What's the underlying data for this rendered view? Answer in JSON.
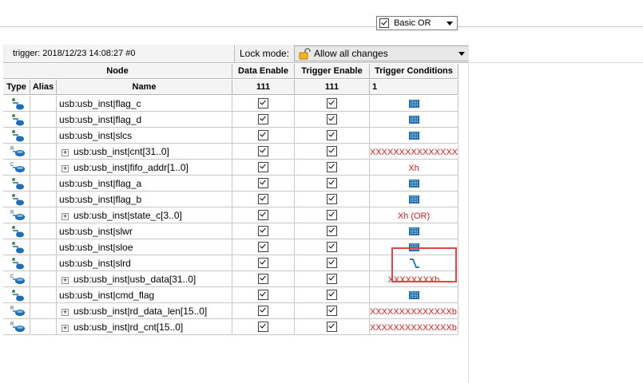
{
  "toolbar": {
    "trigger_info": "trigger: 2018/12/23 14:08:27  #0",
    "lock_mode_label": "Lock mode:",
    "lock_mode_value": "Allow all changes"
  },
  "headers": {
    "node": "Node",
    "type": "Type",
    "alias": "Alias",
    "name": "Name",
    "data_enable": "Data Enable",
    "data_enable_count": "111",
    "trigger_enable": "Trigger Enable",
    "trigger_enable_count": "111",
    "trigger_conditions": "Trigger Conditions",
    "trigger_conditions_count": "1",
    "trigger_mode": "Basic OR"
  },
  "rows": [
    {
      "icon": "input-pin-icon",
      "type_letter": "",
      "expandable": false,
      "name": "usb:usb_inst|flag_c",
      "data_enable": true,
      "trigger_enable": true,
      "condition": "dont-care"
    },
    {
      "icon": "input-pin-icon",
      "type_letter": "",
      "expandable": false,
      "name": "usb:usb_inst|flag_d",
      "data_enable": true,
      "trigger_enable": true,
      "condition": "dont-care"
    },
    {
      "icon": "input-pin-icon",
      "type_letter": "",
      "expandable": false,
      "name": "usb:usb_inst|slcs",
      "data_enable": true,
      "trigger_enable": true,
      "condition": "dont-care"
    },
    {
      "icon": "register-bus-icon",
      "type_letter": "R",
      "expandable": true,
      "name": "usb:usb_inst|cnt[31..0]",
      "data_enable": true,
      "trigger_enable": true,
      "condition": "XXXXXXXXXXXXXXX"
    },
    {
      "icon": "combinational-bus-icon",
      "type_letter": "C",
      "expandable": true,
      "name": "usb:usb_inst|fifo_addr[1..0]",
      "data_enable": true,
      "trigger_enable": true,
      "condition": "Xh"
    },
    {
      "icon": "input-pin-icon",
      "type_letter": "",
      "expandable": false,
      "name": "usb:usb_inst|flag_a",
      "data_enable": true,
      "trigger_enable": true,
      "condition": "dont-care"
    },
    {
      "icon": "input-pin-icon",
      "type_letter": "",
      "expandable": false,
      "name": "usb:usb_inst|flag_b",
      "data_enable": true,
      "trigger_enable": true,
      "condition": "dont-care"
    },
    {
      "icon": "register-bus-icon",
      "type_letter": "R",
      "expandable": true,
      "name": "usb:usb_inst|state_c[3..0]",
      "data_enable": true,
      "trigger_enable": true,
      "condition": "Xh (OR)"
    },
    {
      "icon": "input-pin-icon",
      "type_letter": "",
      "expandable": false,
      "name": "usb:usb_inst|slwr",
      "data_enable": true,
      "trigger_enable": true,
      "condition": "dont-care"
    },
    {
      "icon": "input-pin-icon",
      "type_letter": "",
      "expandable": false,
      "name": "usb:usb_inst|sloe",
      "data_enable": true,
      "trigger_enable": true,
      "condition": "dont-care"
    },
    {
      "icon": "input-pin-icon",
      "type_letter": "",
      "expandable": false,
      "name": "usb:usb_inst|slrd",
      "data_enable": true,
      "trigger_enable": true,
      "condition": "falling-edge"
    },
    {
      "icon": "combinational-bus-icon",
      "type_letter": "C",
      "expandable": true,
      "name": "usb:usb_inst|usb_data[31..0]",
      "data_enable": true,
      "trigger_enable": true,
      "condition": "XXXXXXXXh"
    },
    {
      "icon": "input-pin-icon",
      "type_letter": "",
      "expandable": false,
      "name": "usb:usb_inst|cmd_flag",
      "data_enable": true,
      "trigger_enable": true,
      "condition": "dont-care"
    },
    {
      "icon": "register-bus-icon",
      "type_letter": "R",
      "expandable": true,
      "name": "usb:usb_inst|rd_data_len[15..0]",
      "data_enable": true,
      "trigger_enable": true,
      "condition": "XXXXXXXXXXXXXXb"
    },
    {
      "icon": "register-bus-icon",
      "type_letter": "R",
      "expandable": true,
      "name": "usb:usb_inst|rd_cnt[15..0]",
      "data_enable": true,
      "trigger_enable": true,
      "condition": "XXXXXXXXXXXXXXb"
    }
  ],
  "colors": {
    "highlight_box": "#e04646",
    "condition_text": "#e01b1b",
    "icon_blue": "#1c6fb4"
  }
}
